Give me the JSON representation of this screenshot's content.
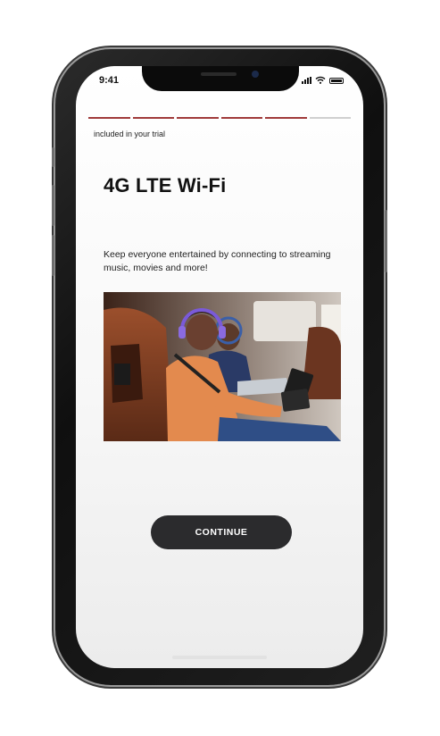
{
  "status_bar": {
    "time": "9:41",
    "icons": [
      "signal-icon",
      "wifi-icon",
      "battery-icon"
    ]
  },
  "progress": {
    "total_steps": 6,
    "completed_steps": 5,
    "active_color": "#a03a3a",
    "inactive_color": "#cfcfcf"
  },
  "content": {
    "trial_label": "included in your trial",
    "title": "4G LTE Wi-Fi",
    "description": "Keep everyone entertained by connecting to streaming music, movies and more!"
  },
  "actions": {
    "continue_label": "CONTINUE"
  },
  "colors": {
    "button_bg": "#2b2b2d",
    "accent": "#a03a3a"
  }
}
